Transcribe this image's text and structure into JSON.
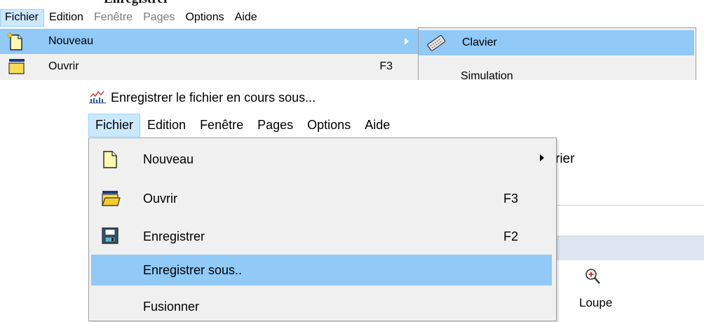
{
  "top": {
    "partial_title": "Enregistrer",
    "menubar": [
      {
        "label": "Fichier",
        "state": "active"
      },
      {
        "label": "Edition",
        "state": "normal"
      },
      {
        "label": "Fenêtre",
        "state": "disabled"
      },
      {
        "label": "Pages",
        "state": "disabled"
      },
      {
        "label": "Options",
        "state": "normal"
      },
      {
        "label": "Aide",
        "state": "normal"
      }
    ],
    "file_menu": [
      {
        "label": "Nouveau",
        "icon": "new-document-icon",
        "has_submenu": true,
        "highlighted": true
      },
      {
        "label": "Ouvrir",
        "shortcut": "F3",
        "icon": "open-folder-icon"
      }
    ],
    "submenu": [
      {
        "label": "Clavier",
        "icon": "keyboard-icon",
        "highlighted": true
      },
      {
        "label": "Simulation"
      }
    ]
  },
  "window": {
    "title": "Enregistrer le fichier en cours sous...",
    "title_icon": "app-chart-icon",
    "menubar": [
      {
        "label": "Fichier",
        "state": "active"
      },
      {
        "label": "Edition",
        "state": "normal"
      },
      {
        "label": "Fenêtre",
        "state": "normal"
      },
      {
        "label": "Pages",
        "state": "normal"
      },
      {
        "label": "Options",
        "state": "normal"
      },
      {
        "label": "Aide",
        "state": "normal"
      }
    ],
    "file_menu": [
      {
        "label": "Nouveau",
        "icon": "new-document-icon",
        "has_submenu": true
      },
      {
        "label": "Ouvrir",
        "shortcut": "F3",
        "icon": "open-folder-icon"
      },
      {
        "label": "Enregistrer",
        "shortcut": "F2",
        "icon": "save-icon"
      },
      {
        "label": "Enregistrer sous..",
        "highlighted": true
      },
      {
        "label": "Fusionner"
      }
    ],
    "background_app": {
      "partial_label": "rier",
      "toolbar_button": "Loupe",
      "toolbar_icon": "zoom-in-icon"
    }
  },
  "colors": {
    "menu_bg": "#f0f0f0",
    "highlight": "#91c9f7",
    "menubar_active": "#cce8ff",
    "disabled_text": "#7a7a7a"
  }
}
